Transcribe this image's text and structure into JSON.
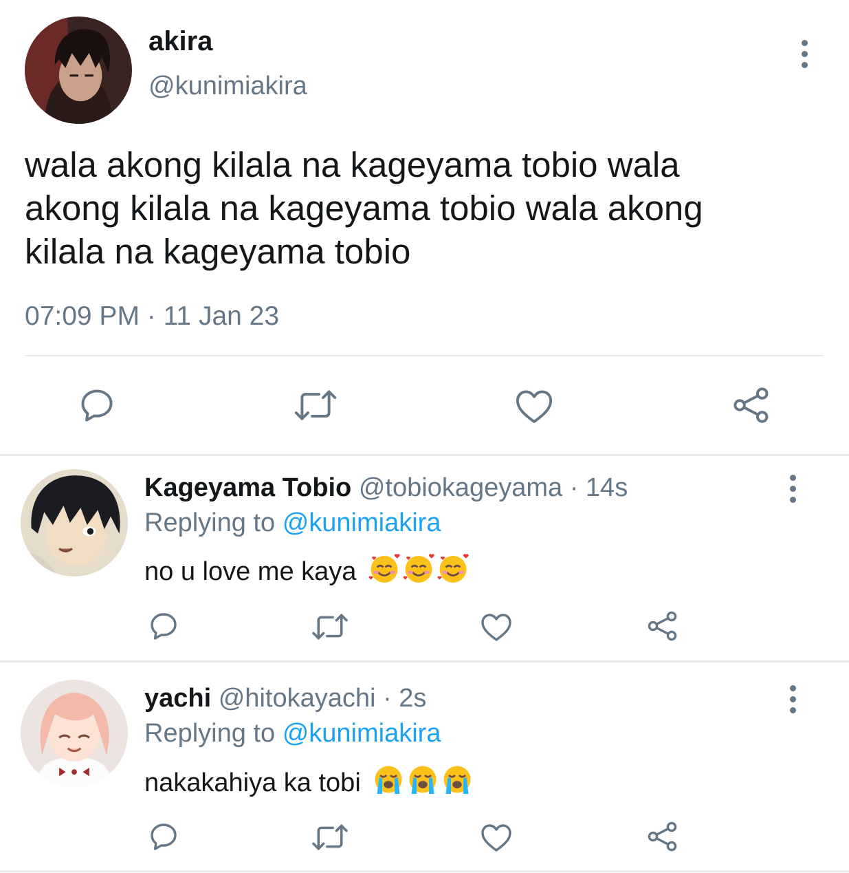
{
  "tweet": {
    "display_name": "akira",
    "handle": "@kunimiakira",
    "text": "wala akong kilala na kageyama tobio wala akong kilala na kageyama tobio wala akong kilala na kageyama tobio",
    "time": "07:09 PM",
    "separator": "·",
    "date": "11 Jan 23",
    "avatar_icon": "avatar-akira",
    "more_icon": "more-vertical-icon"
  },
  "actions": {
    "icons": [
      "reply-icon",
      "retweet-icon",
      "like-icon",
      "share-icon"
    ],
    "color": "#657786"
  },
  "replies": [
    {
      "display_name": "Kageyama Tobio",
      "handle": "@tobiokageyama",
      "separator": "·",
      "time_ago": "14s",
      "replying_prefix": "Replying to",
      "replying_handle": "@kunimiakira",
      "text": "no u love me kaya",
      "emoji": "smiling-face-with-hearts-emoji",
      "emoji_count": 3
    },
    {
      "display_name": "yachi",
      "handle": "@hitokayachi",
      "separator": "·",
      "time_ago": "2s",
      "replying_prefix": "Replying to",
      "replying_handle": "@kunimiakira",
      "text": "nakakahiya ka tobi",
      "emoji": "loudly-crying-face-emoji",
      "emoji_count": 3
    }
  ],
  "colors": {
    "text": "#14171a",
    "secondary": "#657786",
    "link": "#1da1f2",
    "divider": "#e6ecf0"
  }
}
